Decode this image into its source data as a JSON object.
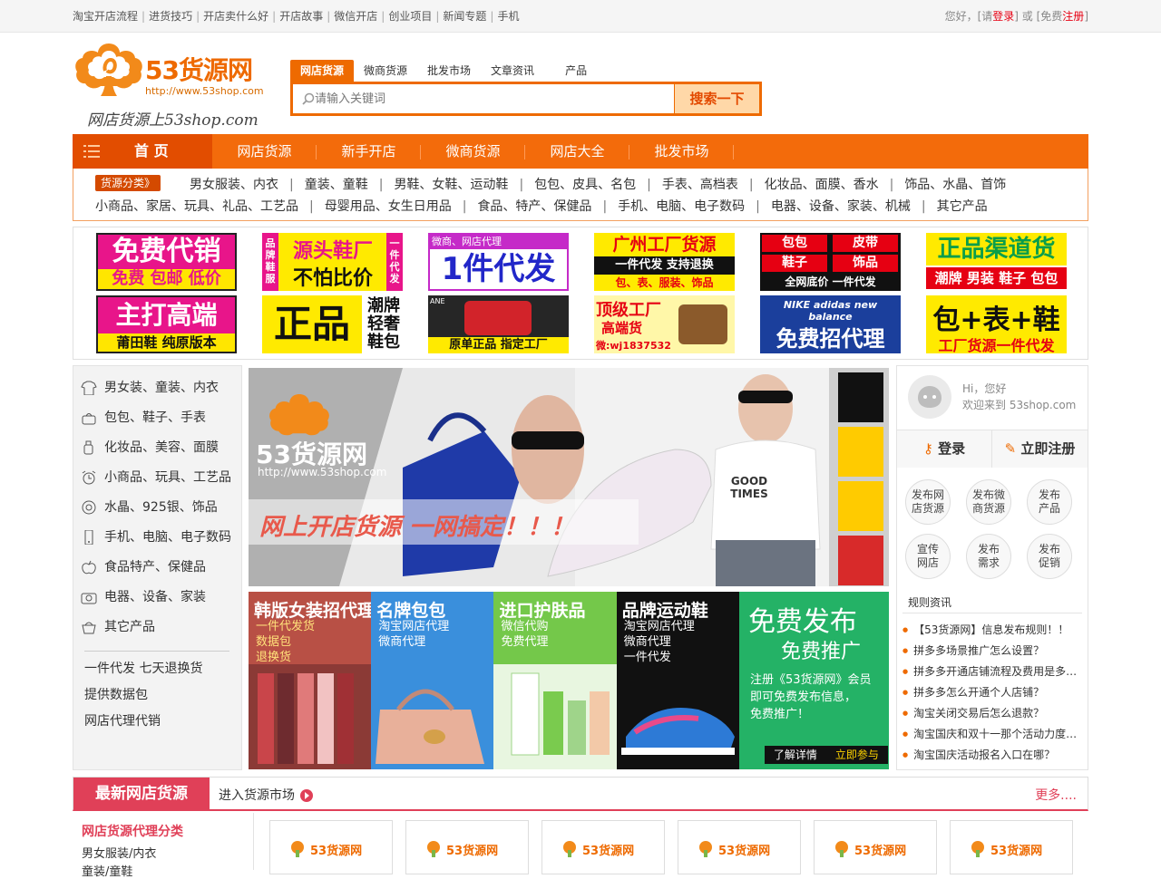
{
  "topbar": {
    "links": [
      "淘宝开店流程",
      "进货技巧",
      "开店卖什么好",
      "开店故事",
      "微信开店",
      "创业项目",
      "新闻专题",
      "手机"
    ],
    "greeting": "您好，[请",
    "login": "登录",
    "or": "] 或 [免费",
    "register": "注册",
    "end": "]"
  },
  "logo": {
    "name": "53货源网",
    "url": "http://www.53shop.com",
    "slogan": "网店货源上53shop.com"
  },
  "search": {
    "tabs": [
      "网店货源",
      "微商货源",
      "批发市场",
      "文章资讯",
      "产品"
    ],
    "placeholder": "请输入关键词",
    "button": "搜索一下"
  },
  "nav": {
    "home": "首 页",
    "items": [
      "网店货源",
      "新手开店",
      "微商货源",
      "网店大全",
      "批发市场"
    ]
  },
  "categories": {
    "badge": "货源分类》",
    "row1": [
      "男女服装、内衣",
      "童装、童鞋",
      "男鞋、女鞋、运动鞋",
      "包包、皮具、名包",
      "手表、高档表",
      "化妆品、面膜、香水",
      "饰品、水晶、首饰"
    ],
    "row2": [
      "小商品、家居、玩具、礼品、工艺品",
      "母婴用品、女生日用品",
      "食品、特产、保健品",
      "手机、电脑、电子数码",
      "电器、设备、家装、机械",
      "其它产品"
    ]
  },
  "ads": [
    {
      "l1": "免费代销",
      "l2": "免费 包邮 低价"
    },
    {
      "l1": "源头鞋厂",
      "l2": "不怕比价",
      "side1": "品牌鞋服",
      "side2": "一件代发"
    },
    {
      "l1": "微商、网店代理",
      "l2": "1件代发"
    },
    {
      "l1": "广州工厂货源",
      "l2": "一件代发 支持退换",
      "l3": "包、表、服装、饰品"
    },
    {
      "l1": "包包",
      "l1b": "皮带",
      "l2": "鞋子",
      "l2b": "饰品",
      "l3": "全网底价 一件代发"
    },
    {
      "l1": "正品渠道货",
      "l2": "潮牌 男装 鞋子 包包"
    },
    {
      "l1": "主打高端",
      "l2": "莆田鞋 纯原版本"
    },
    {
      "l1": "正品",
      "l2": "潮牌",
      "l3": "轻奢",
      "l4": "鞋包"
    },
    {
      "l1": "ANE",
      "l2": "原单正品 指定工厂"
    },
    {
      "l1": "顶级工厂",
      "l2": "高端货",
      "l3": "微:wj1837532"
    },
    {
      "l1": "NIKE adidas new balance",
      "l2": "免费招代理"
    },
    {
      "l1": "包+表+鞋",
      "l2": "工厂货源一件代发"
    }
  ],
  "leftcats": [
    {
      "icon": "shirt-icon",
      "label": "男女装、童装、内衣"
    },
    {
      "icon": "bag-icon",
      "label": "包包、鞋子、手表"
    },
    {
      "icon": "bottle-icon",
      "label": "化妆品、美容、面膜"
    },
    {
      "icon": "alarm-icon",
      "label": "小商品、玩具、工艺品"
    },
    {
      "icon": "gem-icon",
      "label": "水晶、925银、饰品"
    },
    {
      "icon": "phone-icon",
      "label": "手机、电脑、电子数码"
    },
    {
      "icon": "apple-icon",
      "label": "食品特产、保健品"
    },
    {
      "icon": "camera-icon",
      "label": "电器、设备、家装"
    },
    {
      "icon": "basket-icon",
      "label": "其它产品"
    }
  ],
  "leftextra": [
    "一件代发 七天退换货",
    "提供数据包",
    "网店代理代销"
  ],
  "banner": {
    "brand": "53货源网",
    "url": "http://www.53shop.com",
    "slogan": "网上开店货源 一网搞定！！！",
    "tee": "GOOD TIMES"
  },
  "tiles": [
    {
      "title": "韩版女装招代理",
      "lines": [
        "一件代发货",
        "数据包",
        "退换货"
      ],
      "color": "#e26a52"
    },
    {
      "title": "名牌包包",
      "lines": [
        "淘宝网店代理",
        "微商代理"
      ],
      "color": "#3a8fdc"
    },
    {
      "title": "进口护肤品",
      "lines": [
        "微信代购",
        "免费代理"
      ],
      "color": "#74c84a"
    },
    {
      "title": "品牌运动鞋",
      "lines": [
        "淘宝网店代理",
        "微商代理",
        "一件代发"
      ],
      "color": "#111111"
    },
    {
      "title": "免费发布",
      "title2": "免费推广",
      "lines": [
        "注册《53货源网》会员",
        "即可免费发布信息，",
        "免费推广！"
      ],
      "btn1": "了解详情",
      "btn2": "立即参与",
      "color": "#24b266"
    }
  ],
  "sidebar": {
    "hi": "Hi，您好",
    "welcome": "欢迎来到 53shop.com",
    "login": "登录",
    "register": "立即注册",
    "circles": [
      [
        "发布网",
        "店货源"
      ],
      [
        "发布微",
        "商货源"
      ],
      [
        "发布",
        "产品"
      ],
      [
        "宣传",
        "网店"
      ],
      [
        "发布",
        "需求"
      ],
      [
        "发布",
        "促销"
      ]
    ],
    "rules_title": "规则资讯",
    "rules": [
      "【53货源网】信息发布规则！！",
      "拼多多场景推广怎么设置？",
      "拼多多开通店铺流程及费用是多少？",
      "拼多多怎么开通个人店铺？",
      "淘宝关闭交易后怎么退款？",
      "淘宝国庆和双十一那个活动力度大？",
      "淘宝国庆活动报名入口在哪？"
    ]
  },
  "section": {
    "title": "最新网店货源",
    "link": "进入货源市场",
    "more": "更多....",
    "cat_title": "网店货源代理分类",
    "cat_items": [
      "男女服装/内衣",
      "童装/童鞋"
    ],
    "card_logo": "53货源网"
  },
  "colors": {
    "orange": "#ee6a00",
    "nav": "#f36b0b",
    "red": "#e04058"
  }
}
